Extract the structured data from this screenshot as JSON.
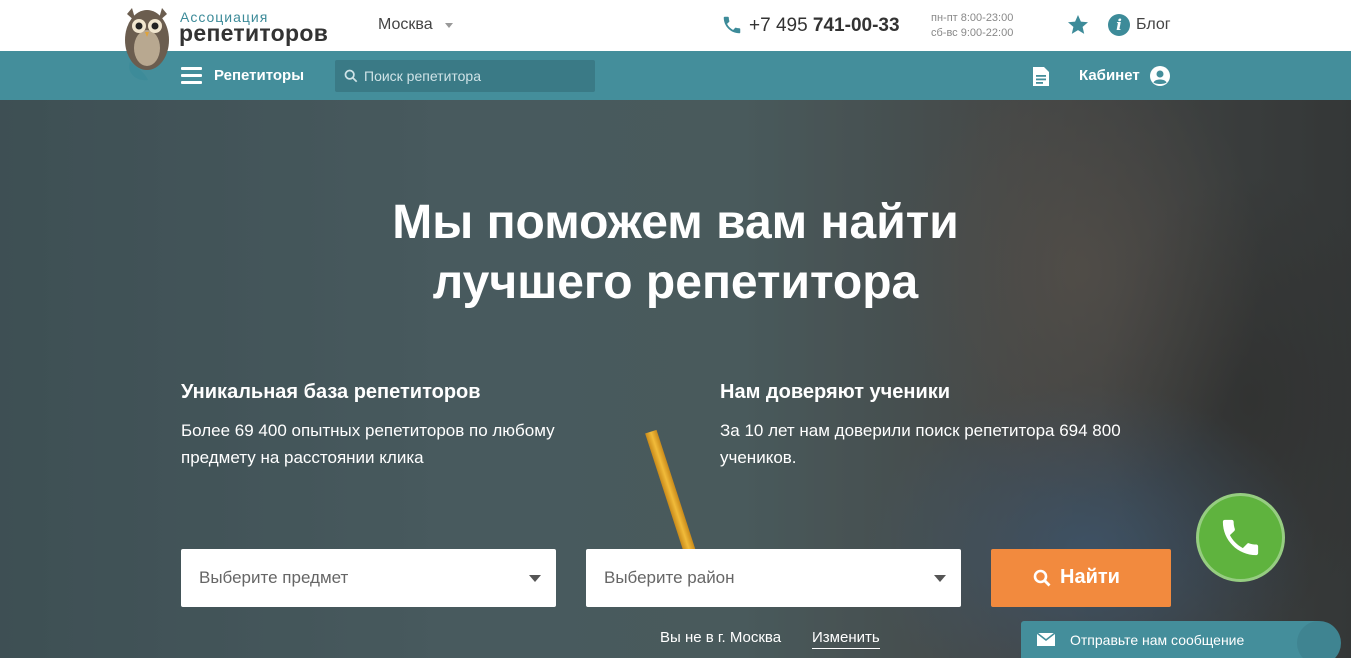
{
  "header": {
    "logo_small": "Ассоциация",
    "logo_big": "репетиторов",
    "city": "Москва",
    "phone_prefix": "+7 495 ",
    "phone_main": "741-00-33",
    "hours_weekday": "пн-пт 8:00-23:00",
    "hours_weekend": "сб-вс 9:00-22:00",
    "blog": "Блог",
    "info_glyph": "i"
  },
  "nav": {
    "menu_label": "Репетиторы",
    "search_placeholder": "Поиск репетитора",
    "cabinet": "Кабинет"
  },
  "hero": {
    "title_line1": "Мы поможем вам найти",
    "title_line2": "лучшего репетитора",
    "features": [
      {
        "title": "Уникальная база репетиторов",
        "text": "Более 69 400 опытных репетиторов по любому предмету на расстоянии клика"
      },
      {
        "title": "Нам доверяют ученики",
        "text": "За 10 лет нам доверили поиск репетитора 694 800 учеников."
      }
    ],
    "subject_select": "Выберите предмет",
    "district_select": "Выберите район",
    "find_button": "Найти",
    "location_note": "Вы не в г. Москва",
    "location_change": "Изменить"
  },
  "widgets": {
    "message_label": "Отправьте нам сообщение"
  },
  "colors": {
    "accent_teal": "#448e9b",
    "button_orange": "#f28a3e",
    "call_green": "#5fb33e"
  },
  "icons": [
    "owl-logo",
    "phone-icon",
    "star-icon",
    "info-icon",
    "menu-icon",
    "search-icon",
    "document-icon",
    "user-icon",
    "phone-call-icon",
    "envelope-icon"
  ]
}
